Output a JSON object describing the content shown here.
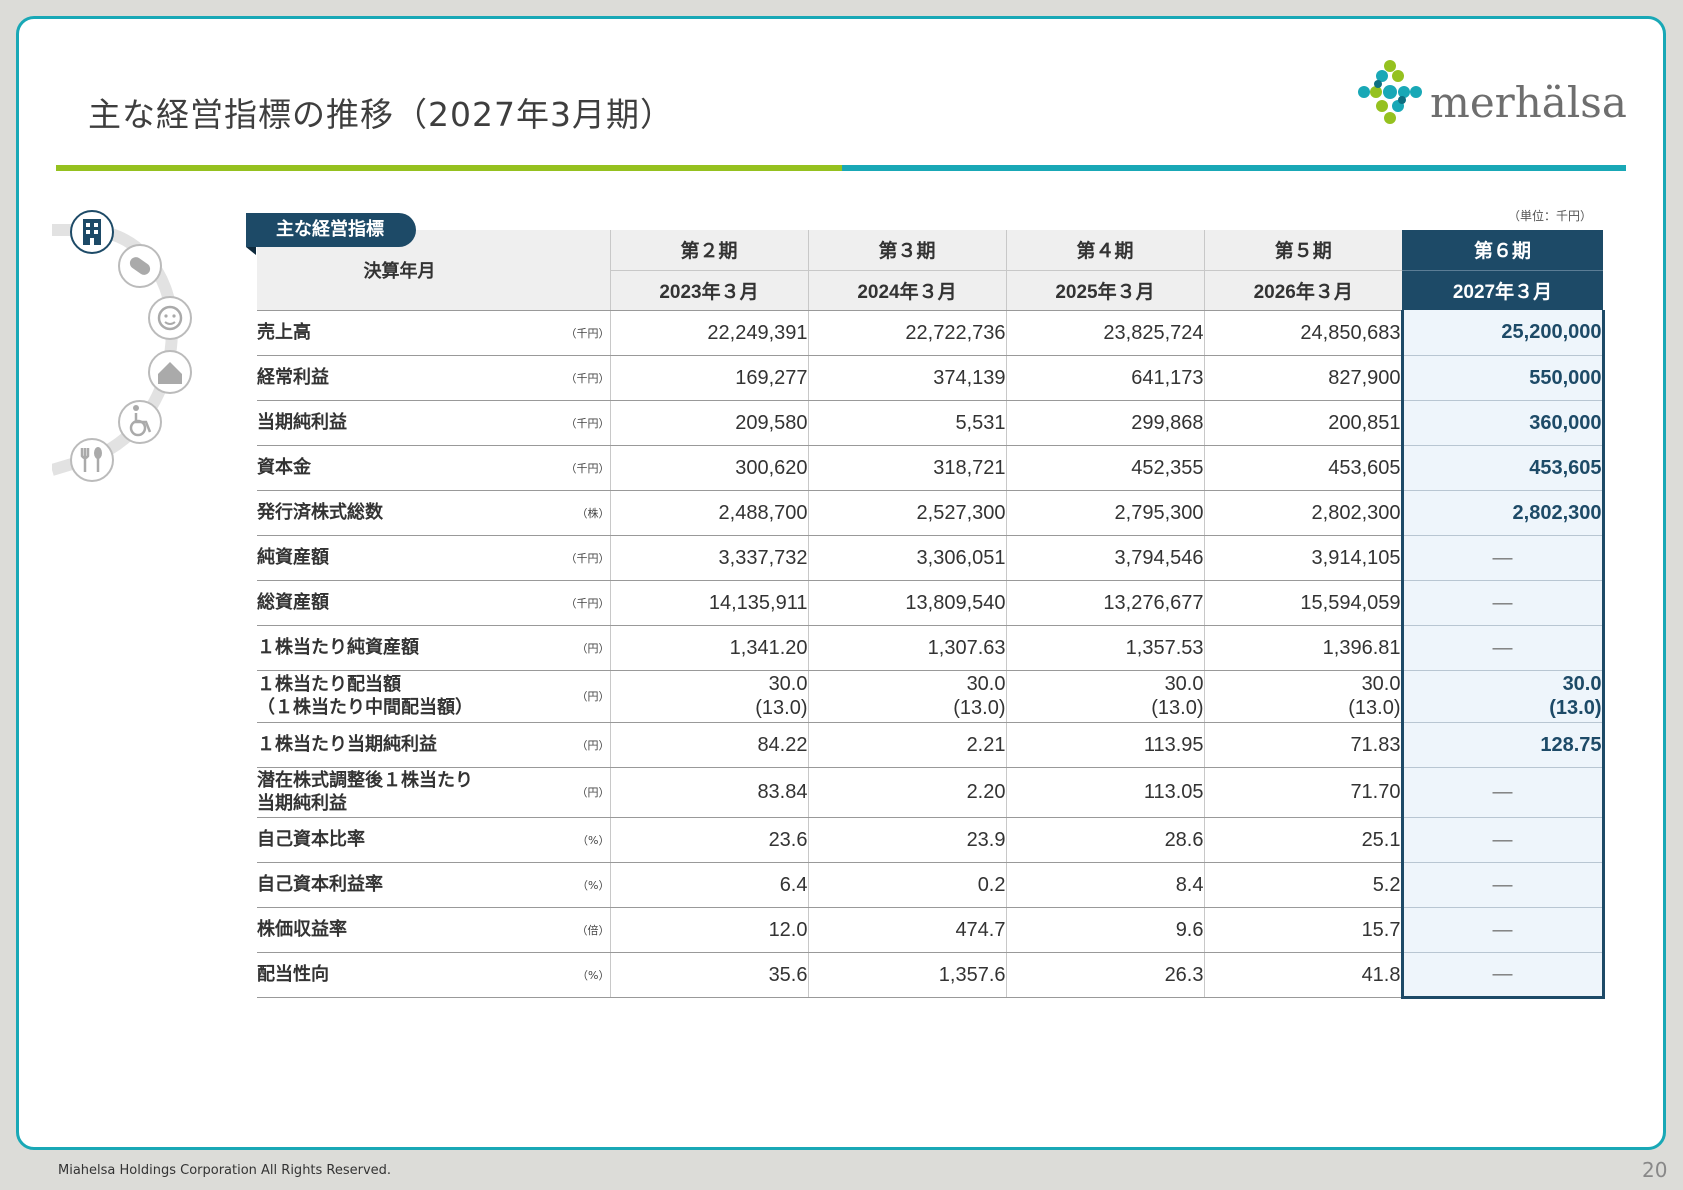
{
  "title": "主な経営指標の推移（2027年3月期）",
  "logo": {
    "text": "merhälsa"
  },
  "nav_icons": [
    "building-icon",
    "pill-icon",
    "face-icon",
    "house-icon",
    "wheelchair-icon",
    "fork-spoon-icon"
  ],
  "unit_note": "（単位：千円）",
  "badge": "主な経営指標",
  "table": {
    "row_header_label": "決算年月",
    "periods": [
      "第２期",
      "第３期",
      "第４期",
      "第５期",
      "第６期"
    ],
    "dates": [
      "2023年３月",
      "2024年３月",
      "2025年３月",
      "2026年３月",
      "2027年３月"
    ],
    "rows": [
      {
        "label": "売上高",
        "unit": "（千円）",
        "values": [
          "22,249,391",
          "22,722,736",
          "23,825,724",
          "24,850,683",
          "25,200,000"
        ]
      },
      {
        "label": "経常利益",
        "unit": "（千円）",
        "values": [
          "169,277",
          "374,139",
          "641,173",
          "827,900",
          "550,000"
        ]
      },
      {
        "label": "当期純利益",
        "unit": "（千円）",
        "values": [
          "209,580",
          "5,531",
          "299,868",
          "200,851",
          "360,000"
        ]
      },
      {
        "label": "資本金",
        "unit": "（千円）",
        "values": [
          "300,620",
          "318,721",
          "452,355",
          "453,605",
          "453,605"
        ]
      },
      {
        "label": "発行済株式総数",
        "unit": "（株）",
        "values": [
          "2,488,700",
          "2,527,300",
          "2,795,300",
          "2,802,300",
          "2,802,300"
        ]
      },
      {
        "label": "純資産額",
        "unit": "（千円）",
        "values": [
          "3,337,732",
          "3,306,051",
          "3,794,546",
          "3,914,105",
          "―"
        ]
      },
      {
        "label": "総資産額",
        "unit": "（千円）",
        "values": [
          "14,135,911",
          "13,809,540",
          "13,276,677",
          "15,594,059",
          "―"
        ]
      },
      {
        "label": "１株当たり純資産額",
        "unit": "（円）",
        "values": [
          "1,341.20",
          "1,307.63",
          "1,357.53",
          "1,396.81",
          "―"
        ]
      },
      {
        "label": "１株当たり配当額\n（１株当たり中間配当額）",
        "unit": "（円）",
        "values": [
          "30.0\n(13.0)",
          "30.0\n(13.0)",
          "30.0\n(13.0)",
          "30.0\n(13.0)",
          "30.0\n(13.0)"
        ]
      },
      {
        "label": "１株当たり当期純利益",
        "unit": "（円）",
        "values": [
          "84.22",
          "2.21",
          "113.95",
          "71.83",
          "128.75"
        ]
      },
      {
        "label": "潜在株式調整後１株当たり\n当期純利益",
        "unit": "（円）",
        "values": [
          "83.84",
          "2.20",
          "113.05",
          "71.70",
          "―"
        ]
      },
      {
        "label": "自己資本比率",
        "unit": "（%）",
        "values": [
          "23.6",
          "23.9",
          "28.6",
          "25.1",
          "―"
        ]
      },
      {
        "label": "自己資本利益率",
        "unit": "（%）",
        "values": [
          "6.4",
          "0.2",
          "8.4",
          "5.2",
          "―"
        ]
      },
      {
        "label": "株価収益率",
        "unit": "（倍）",
        "values": [
          "12.0",
          "474.7",
          "9.6",
          "15.7",
          "―"
        ]
      },
      {
        "label": "配当性向",
        "unit": "（%）",
        "values": [
          "35.6",
          "1,357.6",
          "26.3",
          "41.8",
          "―"
        ]
      }
    ]
  },
  "footer": {
    "copyright": "Miahelsa Holdings Corporation All Rights Reserved.",
    "page_number": "20"
  },
  "colors": {
    "accent_teal": "#19a8b6",
    "accent_green": "#95c11f",
    "navy": "#1d4a67",
    "highlight_bg": "#eef5fb"
  }
}
